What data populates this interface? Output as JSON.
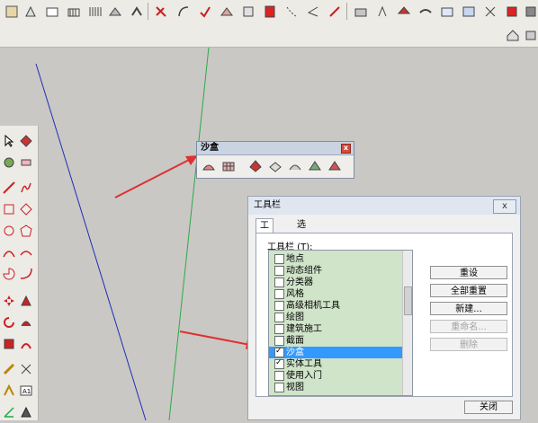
{
  "sandbox": {
    "title": "沙盒",
    "close": "x"
  },
  "dialog": {
    "title": "工具栏",
    "close": "x",
    "tabs": [
      {
        "label": "工具栏"
      },
      {
        "label": "选项"
      }
    ],
    "list_label": "工具栏 (T):",
    "items": [
      {
        "label": "地点",
        "checked": false
      },
      {
        "label": "动态组件",
        "checked": false
      },
      {
        "label": "分类器",
        "checked": false
      },
      {
        "label": "风格",
        "checked": false
      },
      {
        "label": "高级相机工具",
        "checked": false
      },
      {
        "label": "绘图",
        "checked": false
      },
      {
        "label": "建筑施工",
        "checked": false
      },
      {
        "label": "截面",
        "checked": false
      },
      {
        "label": "沙盒",
        "checked": true,
        "selected": true
      },
      {
        "label": "实体工具",
        "checked": true
      },
      {
        "label": "使用入门",
        "checked": false
      },
      {
        "label": "视图",
        "checked": false
      }
    ],
    "buttons": {
      "reset": "重设",
      "reset_all": "全部重置",
      "new": "新建...",
      "rename": "重命名...",
      "delete": "删除"
    },
    "close_label": "关闭"
  },
  "colors": {
    "canvas": "#c9c8c4",
    "axis_blue": "#1f2fb5",
    "axis_green": "#2ea84a",
    "arrow_red": "#e03030",
    "selection": "#3399ff",
    "list_bg": "#cfe4c9"
  }
}
